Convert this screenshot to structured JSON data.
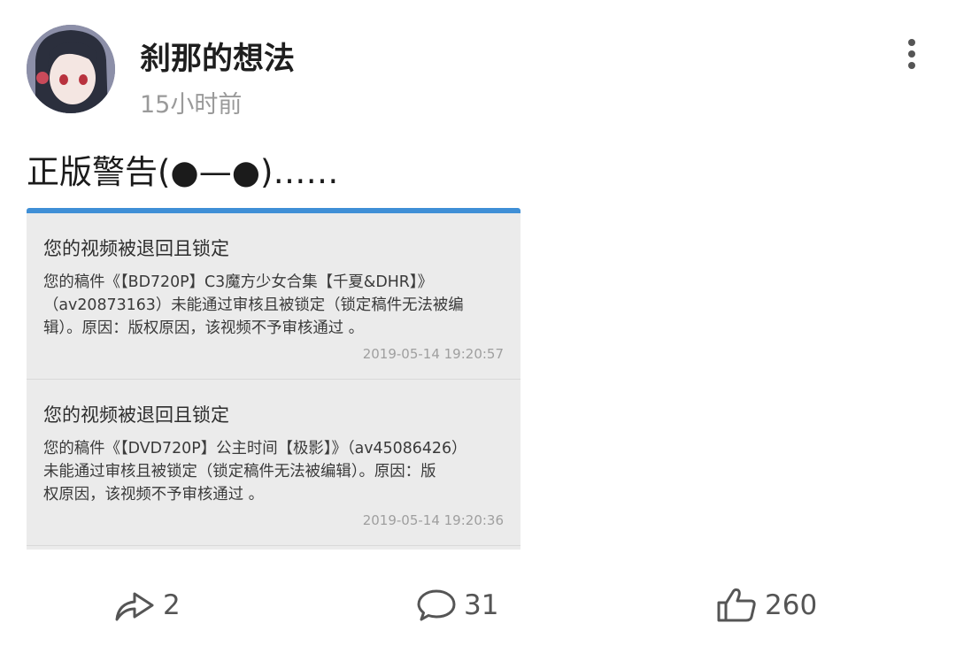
{
  "post": {
    "author": "刹那的想法",
    "time": "15小时前",
    "text": "正版警告(●—●)……"
  },
  "notices": [
    {
      "title": "您的视频被退回且锁定",
      "body": "您的稿件《【BD720P】C3魔方少女合集【千夏&DHR】》\n（av20873163）未能通过审核且被锁定（锁定稿件无法被编\n辑）。原因：版权原因，该视频不予审核通过 。",
      "time": "2019-05-14 19:20:57"
    },
    {
      "title": "您的视频被退回且锁定",
      "body": "您的稿件《【DVD720P】公主时间【极影】》（av45086426）\n未能通过审核且被锁定（锁定稿件无法被编辑）。原因：版\n权原因，该视频不予审核通过 。",
      "time": "2019-05-14 19:20:36"
    }
  ],
  "actions": {
    "share_count": "2",
    "comment_count": "31",
    "like_count": "260"
  },
  "colors": {
    "accent_bar": "#3f8fd6",
    "card_bg": "#ebebeb",
    "muted_text": "#9a9a9a"
  },
  "icons": {
    "more": "more-vertical-icon",
    "share": "share-arrow-icon",
    "comment": "comment-bubble-icon",
    "like": "thumbs-up-icon"
  }
}
